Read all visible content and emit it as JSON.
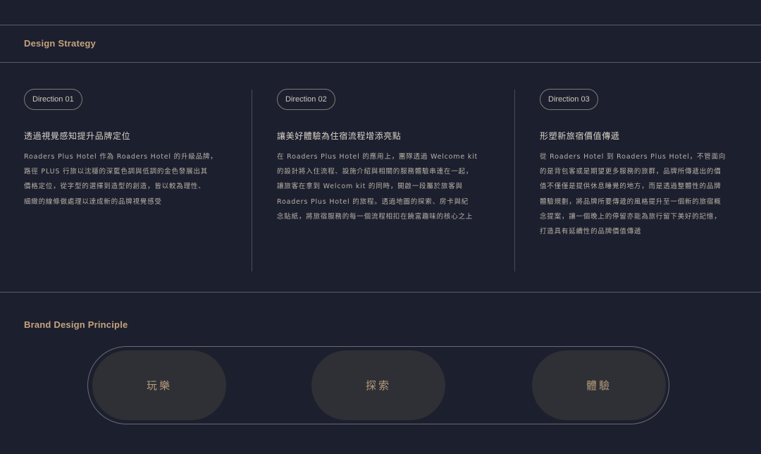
{
  "sections": {
    "strategy_title": "Design Strategy",
    "principle_title": "Brand Design Principle"
  },
  "directions": [
    {
      "label": "Direction 01",
      "heading": "透過視覺感知提升品牌定位",
      "lines": [
        "Roaders Plus Hotel 作為 Roaders Hotel 的升級品牌，",
        "路徑 PLUS 行旅以沈穩的深藍色調與低調的金色發展出其",
        "價格定位，從字型的選擇到造型的創造，皆以較為理性、",
        "細緻的線條做處理以達成新的品牌視覺感受"
      ]
    },
    {
      "label": "Direction 02",
      "heading": "讓美好體驗為住宿流程增添亮點",
      "lines": [
        "在 Roaders Plus Hotel 的應用上，團隊透過 Welcome kit",
        "的設計將入住流程、設施介紹與相關的服務體驗串連在一起，",
        "讓旅客在拿到 Welcom kit 的同時，開啟一段屬於旅客與",
        "Roaders Plus Hotel 的旅程。透過地圖的探索、房卡與紀",
        "念貼紙，將旅宿服務的每一個流程相扣在饒富趣味的核心之上"
      ]
    },
    {
      "label": "Direction 03",
      "heading": "形塑新旅宿價值傳遞",
      "lines": [
        "從 Roaders Hotel 到 Roaders Plus Hotel，不管面向",
        "的是背包客或是期望更多服務的旅群，品牌所傳遞出的價",
        "值不僅僅是提供休息睡覺的地方，而是透過整體性的品牌",
        "體驗規劃，將品牌所要傳遞的風格提升至一個新的旅宿概",
        "念提案，讓一個晚上的停留亦能為旅行留下美好的記憶，",
        "打造具有延續性的品牌價值傳遞"
      ]
    }
  ],
  "principles": [
    "玩樂",
    "探索",
    "體驗"
  ]
}
